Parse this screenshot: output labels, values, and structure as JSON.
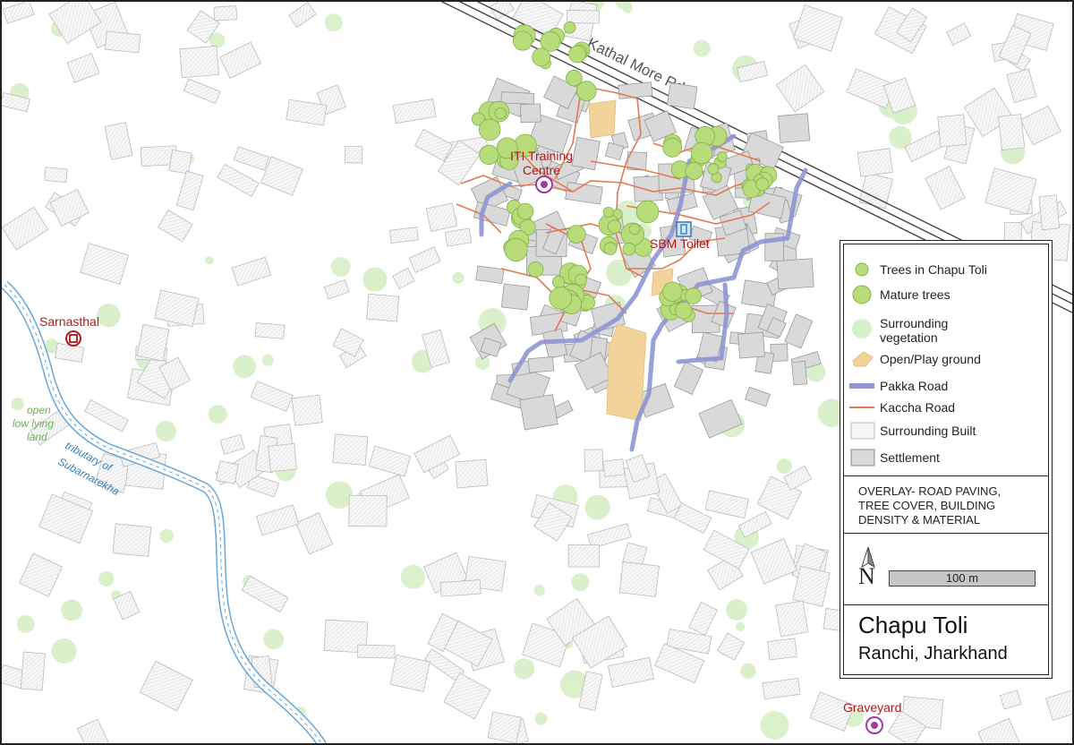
{
  "map": {
    "road_name": "Kathal More Rd",
    "places": {
      "iti": "ITI Training Centre",
      "iti_line1": "ITI Training",
      "iti_line2": "Centre",
      "sbm": "SBM Toilet",
      "sarnasthal": "Sarnasthal",
      "graveyard": "Graveyard",
      "open_land_1": "open",
      "open_land_2": "low lying",
      "open_land_3": "land",
      "river_1": "tributary of",
      "river_2": "Subarnarekha"
    }
  },
  "legend": {
    "items": [
      {
        "label": "Trees in Chapu Toli"
      },
      {
        "label": "Mature trees"
      },
      {
        "label": "Surrounding",
        "label2": "vegetation"
      },
      {
        "label": "Open/Play ground"
      },
      {
        "label": "Pakka Road"
      },
      {
        "label": "Kaccha Road"
      },
      {
        "label": "Surrounding Built"
      },
      {
        "label": "Settlement"
      }
    ],
    "overlay_1": "OVERLAY- ROAD PAVING,",
    "overlay_2": "TREE COVER, BUILDING",
    "overlay_3": "DENSITY & MATERIAL",
    "north": "N",
    "scale": "100 m",
    "title": "Chapu Toli",
    "subtitle": "Ranchi, Jharkhand"
  },
  "colors": {
    "pakka": "#8f95d3",
    "kaccha": "#e07a52",
    "settlement": "#d9d9d9",
    "open_ground": "#f2d49b",
    "tree": "#b8dc7a",
    "vegetation": "#d6f0c8",
    "water": "#5a9fd0",
    "landmark": "#b01a1a",
    "marker": "#a03aa8"
  }
}
